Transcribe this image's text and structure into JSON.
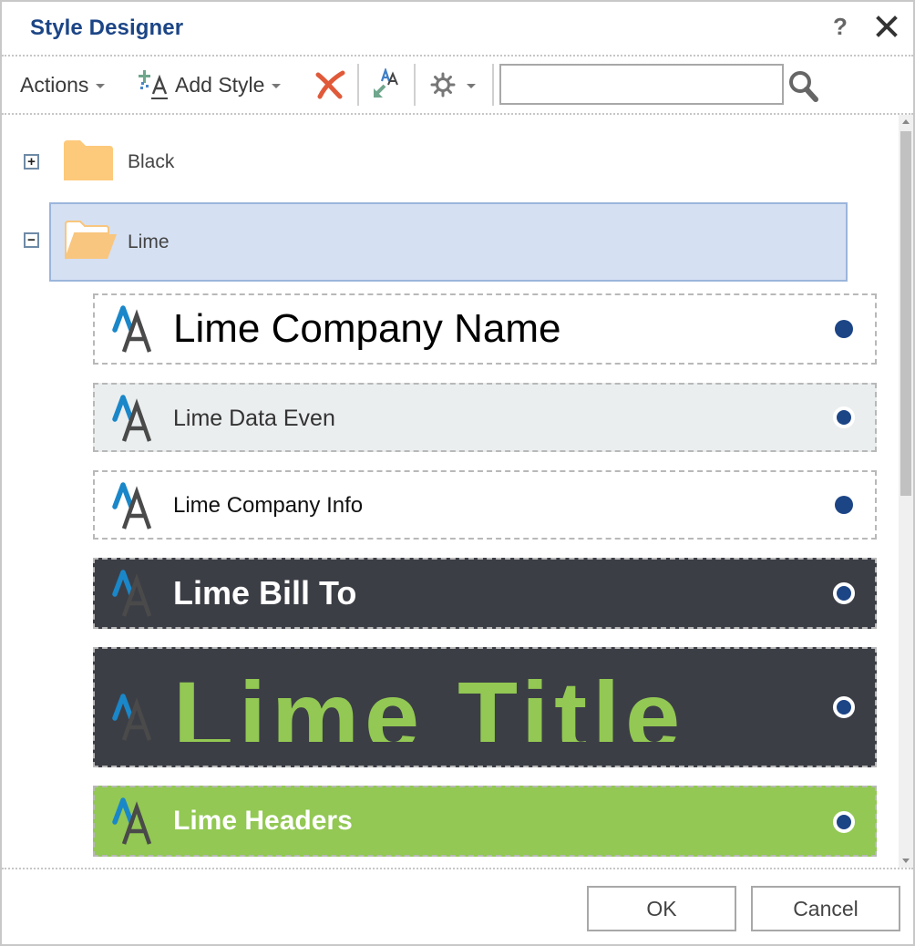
{
  "dialog": {
    "title": "Style Designer",
    "help_label": "?",
    "close_icon": "close-icon"
  },
  "toolbar": {
    "actions_label": "Actions",
    "add_style_label": "Add Style",
    "delete_icon": "delete-x-icon",
    "apply_style_icon": "apply-style-icon",
    "settings_icon": "gear-icon",
    "search_value": "",
    "search_placeholder": "",
    "search_icon": "search-icon"
  },
  "tree": {
    "folders": [
      {
        "label": "Black",
        "expanded": false,
        "toggle": "+"
      },
      {
        "label": "Lime",
        "expanded": true,
        "selected": true,
        "toggle": "−"
      }
    ],
    "styles": [
      {
        "label": "Lime Company Name",
        "background": "#ffffff",
        "text_color": "#000000",
        "default": false
      },
      {
        "label": "Lime Data Even",
        "background": "#ebeeef",
        "text_color": "#333333",
        "default": false
      },
      {
        "label": "Lime Company Info",
        "background": "#ffffff",
        "text_color": "#111111",
        "default": false
      },
      {
        "label": "Lime Bill To",
        "background": "#3c3e46",
        "text_color": "#ffffff",
        "default": false
      },
      {
        "label": "Lime Title",
        "background": "#3c3e46",
        "text_color": "#92c853",
        "default": false
      },
      {
        "label": "Lime Headers",
        "background": "#92c853",
        "text_color": "#ffffff",
        "default": false
      }
    ]
  },
  "footer": {
    "ok_label": "OK",
    "cancel_label": "Cancel"
  },
  "colors": {
    "title": "#1c4586",
    "selection_bg": "#d5e0f2",
    "selection_border": "#9bb5db",
    "folder": "#fdc97a",
    "aa_blue": "#1a87c9",
    "aa_gray": "#4a4a4a",
    "radio": "#1c4586",
    "delete": "#e05a3a"
  }
}
